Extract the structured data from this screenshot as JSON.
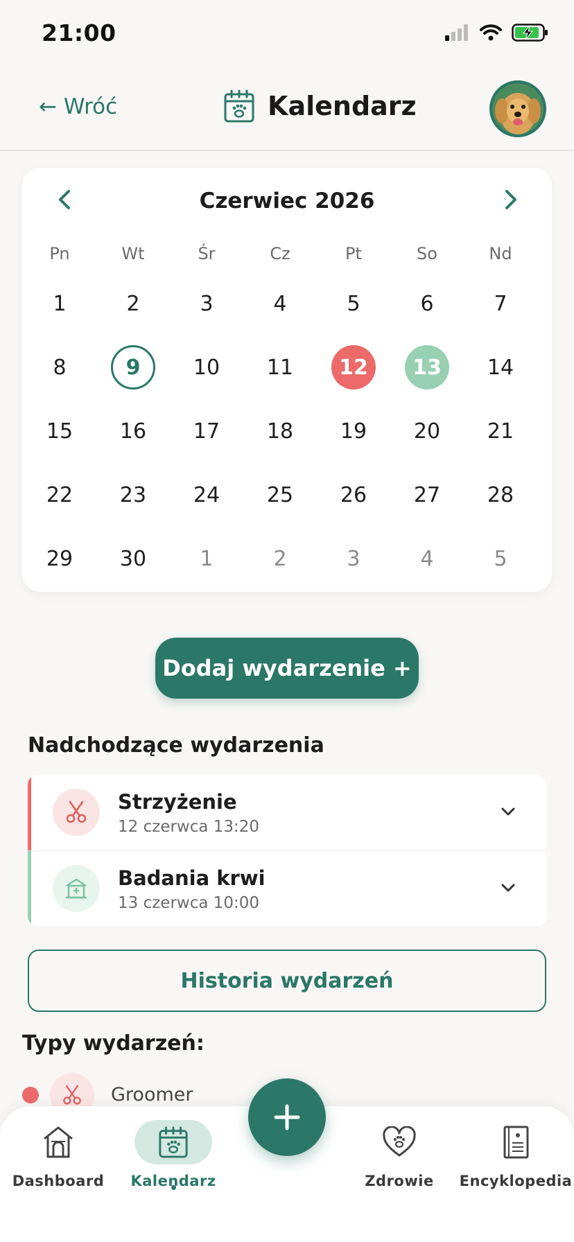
{
  "status_bar": {
    "time": "21:00"
  },
  "header": {
    "back_label": "← Wróć",
    "title": "Kalendarz"
  },
  "calendar": {
    "month_label": "Czerwiec 2026",
    "weekdays": [
      "Pn",
      "Wt",
      "Śr",
      "Cz",
      "Pt",
      "So",
      "Nd"
    ],
    "weeks": [
      [
        "1",
        "2",
        "3",
        "4",
        "5",
        "6",
        "7"
      ],
      [
        "8",
        "9",
        "10",
        "11",
        "12",
        "13",
        "14"
      ],
      [
        "15",
        "16",
        "17",
        "18",
        "19",
        "20",
        "21"
      ],
      [
        "22",
        "23",
        "24",
        "25",
        "26",
        "27",
        "28"
      ],
      [
        "29",
        "30",
        "1",
        "2",
        "3",
        "4",
        "5"
      ]
    ],
    "today": "9",
    "event_red_day": "12",
    "event_green_day": "13"
  },
  "add_event_label": "Dodaj wydarzenie +",
  "upcoming": {
    "title": "Nadchodzące wydarzenia",
    "events": [
      {
        "name": "Strzyżenie",
        "date": "12 czerwca 13:20",
        "icon": "scissors-icon",
        "color": "#ec6a6a"
      },
      {
        "name": "Badania krwi",
        "date": "13 czerwca 10:00",
        "icon": "clinic-icon",
        "color": "#97d0b3"
      }
    ]
  },
  "history_label": "Historia wydarzeń",
  "types": {
    "title": "Typy wydarzeń:",
    "items": [
      {
        "label": "Groomer",
        "color": "#ec6a6a",
        "icon": "scissors-icon"
      }
    ]
  },
  "bottom_nav": {
    "items": [
      {
        "label": "Dashboard",
        "icon": "doghouse-icon"
      },
      {
        "label": "Kalendarz",
        "icon": "calendar-paw-icon"
      },
      {
        "label": "Zdrowie",
        "icon": "heart-paw-icon"
      },
      {
        "label": "Encyklopedia",
        "icon": "book-icon"
      }
    ],
    "fab_icon": "plus-icon"
  },
  "colors": {
    "primary": "#2b7768",
    "event_red": "#ec6a6a",
    "event_green": "#97d0b3",
    "background": "#f8f7f5"
  }
}
